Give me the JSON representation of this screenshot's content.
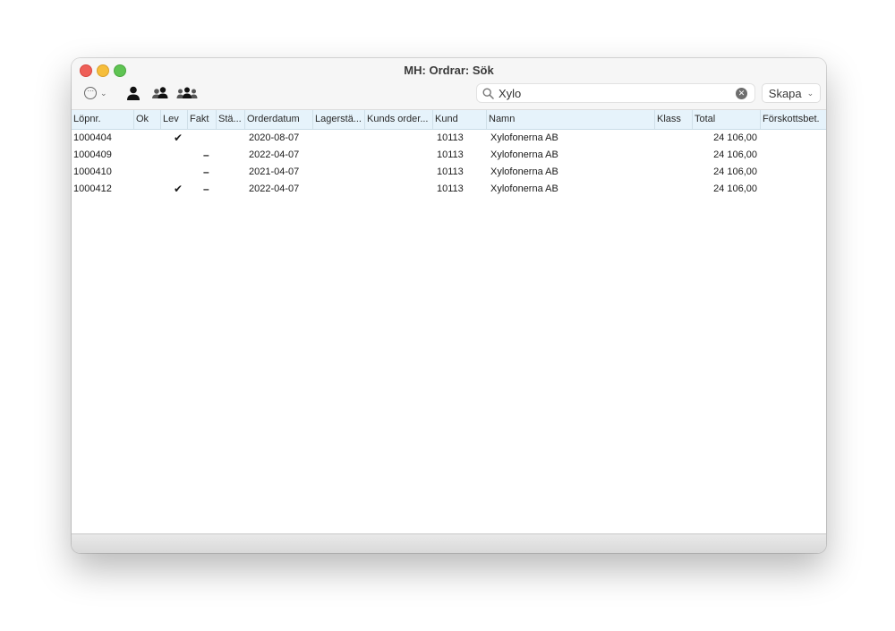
{
  "window": {
    "title": "MH: Ordrar: Sök"
  },
  "toolbar": {
    "more_icon": "ellipsis-circle-icon",
    "more_chevron": "⌄",
    "person_icons": [
      "person-icon",
      "two-persons-icon",
      "three-persons-icon"
    ],
    "search": {
      "value": "Xylo",
      "placeholder": "Sök"
    },
    "create_label": "Skapa",
    "create_chevron": "⌄"
  },
  "table": {
    "columns": [
      "Löpnr.",
      "Ok",
      "Lev",
      "Fakt",
      "Stä...",
      "Orderdatum",
      "Lagerstä...",
      "Kunds order...",
      "Kund",
      "Namn",
      "Klass",
      "Total",
      "Förskottsbet."
    ],
    "rows": [
      {
        "lopnr": "1000404",
        "ok": "",
        "lev": "✔",
        "fakt": "",
        "sta": "",
        "orderdatum": "2020-08-07",
        "lager": "",
        "kundsorder": "",
        "kund": "10113",
        "namn": "Xylofonerna AB",
        "klass": "",
        "total": "24 106,00",
        "forskott": ""
      },
      {
        "lopnr": "1000409",
        "ok": "",
        "lev": "",
        "fakt": "–",
        "sta": "",
        "orderdatum": "2022-04-07",
        "lager": "",
        "kundsorder": "",
        "kund": "10113",
        "namn": "Xylofonerna AB",
        "klass": "",
        "total": "24 106,00",
        "forskott": ""
      },
      {
        "lopnr": "1000410",
        "ok": "",
        "lev": "",
        "fakt": "–",
        "sta": "",
        "orderdatum": "2021-04-07",
        "lager": "",
        "kundsorder": "",
        "kund": "10113",
        "namn": "Xylofonerna AB",
        "klass": "",
        "total": "24 106,00",
        "forskott": ""
      },
      {
        "lopnr": "1000412",
        "ok": "",
        "lev": "✔",
        "fakt": "–",
        "sta": "",
        "orderdatum": "2022-04-07",
        "lager": "",
        "kundsorder": "",
        "kund": "10113",
        "namn": "Xylofonerna AB",
        "klass": "",
        "total": "24 106,00",
        "forskott": ""
      }
    ]
  }
}
